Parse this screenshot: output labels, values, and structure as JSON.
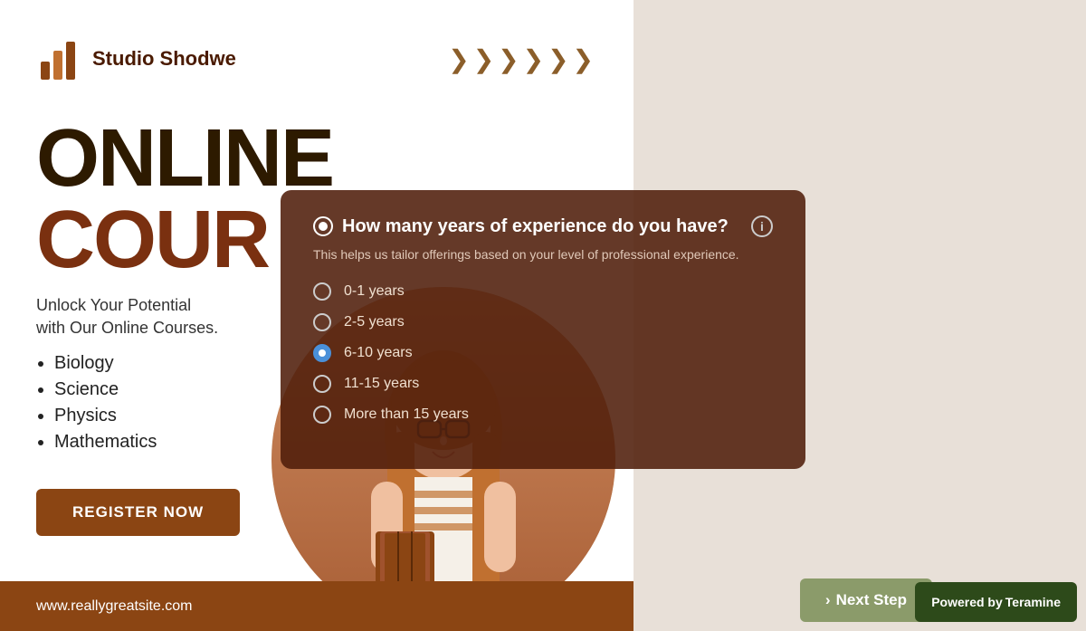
{
  "brand": {
    "name": "Studio Shodwe",
    "chevrons": "»»»»»»"
  },
  "hero": {
    "line1": "ONLINE",
    "line2": "COUR",
    "subtitle_line1": "Unlock Your Potential",
    "subtitle_line2": "with Our Online Courses."
  },
  "courses": {
    "items": [
      "Biology",
      "Science",
      "Physics",
      "Mathematics"
    ]
  },
  "register_button": "REGISTER NOW",
  "footer": {
    "url": "www.reallygreatsite.com"
  },
  "survey": {
    "question": "How many years of experience do you have?",
    "description": "This helps us tailor offerings based on your level of professional experience.",
    "options": [
      {
        "label": "0-1 years",
        "selected": false
      },
      {
        "label": "2-5 years",
        "selected": false
      },
      {
        "label": "6-10 years",
        "selected": true
      },
      {
        "label": "11-15 years",
        "selected": false
      },
      {
        "label": "More than 15 years",
        "selected": false
      }
    ]
  },
  "next_step_button": "Next Step",
  "powered_by": {
    "prefix": "Powered by",
    "brand": "Teramine"
  }
}
